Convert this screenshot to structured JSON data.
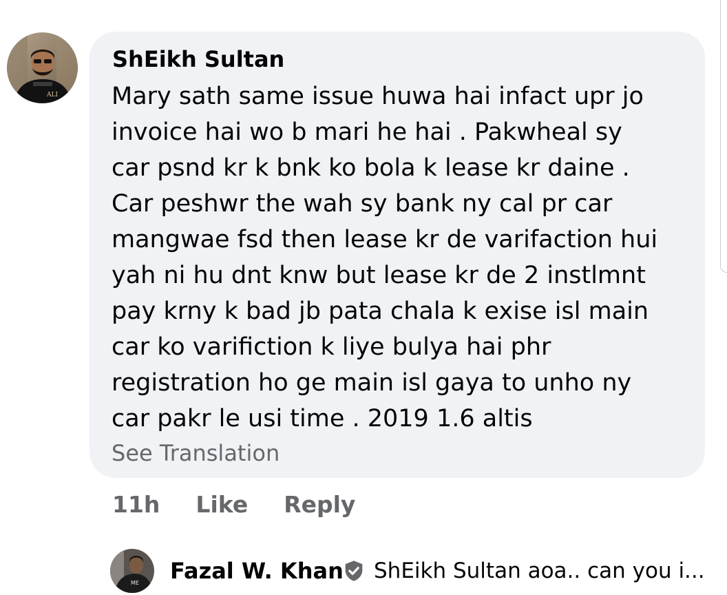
{
  "comment": {
    "author": "ShEikh Sultan",
    "text": "Mary sath same issue huwa hai infact upr jo\ninvoice hai wo b mari he hai . Pakwheal sy\ncar psnd kr k bnk ko bola k lease kr daine .\nCar peshwr the wah sy bank ny cal pr car\nmangwae fsd then lease kr de varifaction hui\nyah ni hu dnt knw but lease kr de 2 instlmnt\npay krny k bad jb pata chala k exise isl main\ncar ko varifiction k liye bulya hai phr\nregistration ho ge main isl gaya to unho ny\ncar pakr le usi time . 2019 1.6 altis",
    "see_translation": "See Translation",
    "time": "11h",
    "like_label": "Like",
    "reply_label": "Reply",
    "avatar_icon": "user-photo-avatar"
  },
  "reply": {
    "author": "Fazal W. Khan",
    "verified_icon": "shield-check-icon",
    "preview": "ShEikh Sultan aoa.. can you i...",
    "avatar_icon": "user-photo-avatar"
  },
  "colors": {
    "bubble_bg": "#f0f2f5",
    "text_primary": "#050505",
    "text_secondary": "#65676b"
  }
}
